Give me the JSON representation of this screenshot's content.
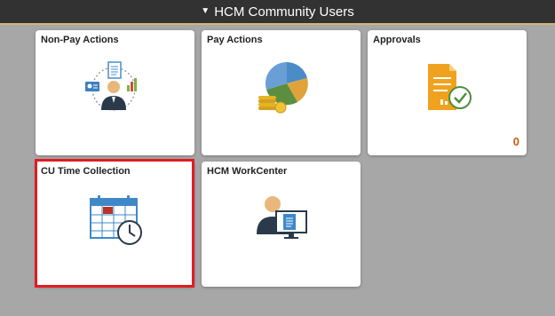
{
  "header": {
    "title": "HCM Community Users",
    "caret_icon": "caret-down-icon"
  },
  "tiles": [
    {
      "label": "Non-Pay Actions",
      "icon": "people-workflow-icon",
      "count": ""
    },
    {
      "label": "Pay Actions",
      "icon": "pie-chart-coins-icon",
      "count": ""
    },
    {
      "label": "Approvals",
      "icon": "document-approved-icon",
      "count": "0"
    },
    {
      "label": "CU Time Collection",
      "icon": "calendar-clock-icon",
      "count": ""
    },
    {
      "label": "HCM WorkCenter",
      "icon": "user-monitor-document-icon",
      "count": ""
    }
  ],
  "colors": {
    "background": "#a7a7a7",
    "header_bg": "#323232",
    "header_accent": "#d7b27a",
    "count_color": "#c85a12",
    "highlight": "#e31b23"
  }
}
